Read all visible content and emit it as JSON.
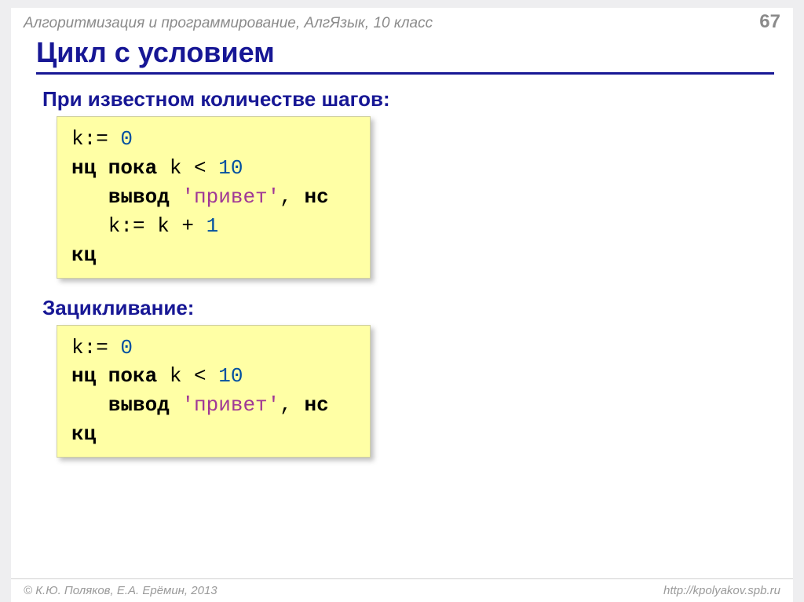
{
  "header": {
    "breadcrumb": "Алгоритмизация и программирование, АлгЯзык, 10 класс",
    "page_number": "67"
  },
  "title": "Цикл с условием",
  "section1": {
    "heading": "При известном количестве шагов:",
    "line1_a": "k:= ",
    "line1_num": "0",
    "line2_a": "нц пока",
    "line2_b": " k < ",
    "line2_num": "10",
    "line3_a": "вывод",
    "line3_b": " ",
    "line3_str": "'привет'",
    "line3_c": ", ",
    "line3_d": "нс",
    "line4_a": "   k:= k + ",
    "line4_num": "1",
    "line5_a": "кц"
  },
  "section2": {
    "heading": "Зацикливание:",
    "line1_a": "k:= ",
    "line1_num": "0",
    "line2_a": "нц пока",
    "line2_b": " k < ",
    "line2_num": "10",
    "line3_a": "вывод",
    "line3_b": " ",
    "line3_str": "'привет'",
    "line3_c": ", ",
    "line3_d": "нс",
    "line4_a": "кц"
  },
  "footer": {
    "copyright": "© К.Ю. Поляков, Е.А. Ерёмин, 2013",
    "url": "http://kpolyakov.spb.ru"
  }
}
